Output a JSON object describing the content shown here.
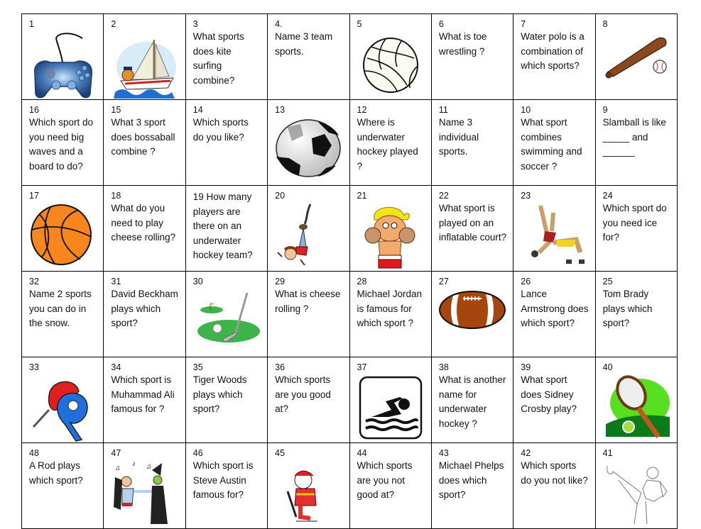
{
  "board": {
    "rows": [
      [
        {
          "num": "1",
          "type": "image",
          "icon": "game-controller-icon"
        },
        {
          "num": "2",
          "type": "image",
          "icon": "sailboat-icon"
        },
        {
          "num": "3",
          "type": "question",
          "text": "What sports does kite surfing combine?"
        },
        {
          "num": "4.",
          "type": "question",
          "text": "Name 3 team sports."
        },
        {
          "num": "5",
          "type": "image",
          "icon": "volleyball-icon"
        },
        {
          "num": "6",
          "type": "question",
          "text": "What is toe wrestling ?"
        },
        {
          "num": "7",
          "type": "question",
          "text": "Water polo is a combination of which sports?"
        },
        {
          "num": "8",
          "type": "image",
          "icon": "baseball-bat-icon"
        }
      ],
      [
        {
          "num": "16",
          "type": "question",
          "text": "Which sport do you need big waves and a board to do?"
        },
        {
          "num": "15",
          "type": "question",
          "text": "What 3 sport does bossaball combine ?"
        },
        {
          "num": "14",
          "type": "question",
          "text": "Which sports do you like?"
        },
        {
          "num": "13",
          "type": "image",
          "icon": "soccer-ball-icon"
        },
        {
          "num": "12",
          "type": "question",
          "text": "Where is underwater hockey played ?"
        },
        {
          "num": "11",
          "type": "question",
          "text": "Name 3 individual sports."
        },
        {
          "num": "10",
          "type": "question",
          "text": "What sport combines swimming and soccer ?"
        },
        {
          "num": "9",
          "type": "question",
          "text": "Slamball is like _____ and ______"
        }
      ],
      [
        {
          "num": "17",
          "type": "image",
          "icon": "basketball-icon"
        },
        {
          "num": "18",
          "type": "question",
          "text": "What do you need to play cheese rolling?"
        },
        {
          "num": "19",
          "type": "question-inline",
          "text": "How many players are there on an underwater hockey team?"
        },
        {
          "num": "20",
          "type": "image",
          "icon": "bungee-jumper-icon"
        },
        {
          "num": "21",
          "type": "image",
          "icon": "boxer-icon"
        },
        {
          "num": "22",
          "type": "question",
          "text": "What sport is played on an inflatable court?"
        },
        {
          "num": "23",
          "type": "image",
          "icon": "wrestlers-icon"
        },
        {
          "num": "24",
          "type": "question",
          "text": "Which sport do you need ice for?"
        }
      ],
      [
        {
          "num": "32",
          "type": "question",
          "text": "Name 2 sports you can do in the snow."
        },
        {
          "num": "31",
          "type": "question",
          "text": "David Beckham plays which sport?"
        },
        {
          "num": "30",
          "type": "image",
          "icon": "golf-icon"
        },
        {
          "num": "29",
          "type": "question",
          "text": "What is cheese rolling ?"
        },
        {
          "num": "28",
          "type": "question",
          "text": "Michael Jordan is famous for which sport ?"
        },
        {
          "num": "27",
          "type": "image",
          "icon": "american-football-icon"
        },
        {
          "num": "26",
          "type": "question",
          "text": "Lance Armstrong does which sport?"
        },
        {
          "num": "25",
          "type": "question",
          "text": "Tom Brady plays which sport?"
        }
      ],
      [
        {
          "num": "33",
          "type": "image",
          "icon": "ping-pong-paddles-icon"
        },
        {
          "num": "34",
          "type": "question",
          "text": "Which sport is Muhammad Ali famous for ?"
        },
        {
          "num": "35",
          "type": "question",
          "text": "Tiger Woods plays which sport?"
        },
        {
          "num": "36",
          "type": "question",
          "text": "Which sports are you good at?"
        },
        {
          "num": "37",
          "type": "image",
          "icon": "swimmer-sign-icon"
        },
        {
          "num": "38",
          "type": "question",
          "text": "What is another name for underwater hockey ?"
        },
        {
          "num": "39",
          "type": "question",
          "text": "What sport does Sidney Crosby play?"
        },
        {
          "num": "40",
          "type": "image",
          "icon": "tennis-racket-icon"
        }
      ],
      [
        {
          "num": "48",
          "type": "question",
          "text": "A Rod plays which sport?"
        },
        {
          "num": "47",
          "type": "image",
          "icon": "dancers-icon"
        },
        {
          "num": "46",
          "type": "question",
          "text": "Which sport is Steve Austin famous for?"
        },
        {
          "num": "45",
          "type": "image",
          "icon": "hockey-player-icon"
        },
        {
          "num": "44",
          "type": "question",
          "text": "Which sports are you not good at?"
        },
        {
          "num": "43",
          "type": "question",
          "text": "Michael Phelps does which sport?"
        },
        {
          "num": "42",
          "type": "question",
          "text": "Which sports do you not like?"
        },
        {
          "num": "41",
          "type": "image",
          "icon": "karate-kick-icon"
        }
      ]
    ]
  }
}
